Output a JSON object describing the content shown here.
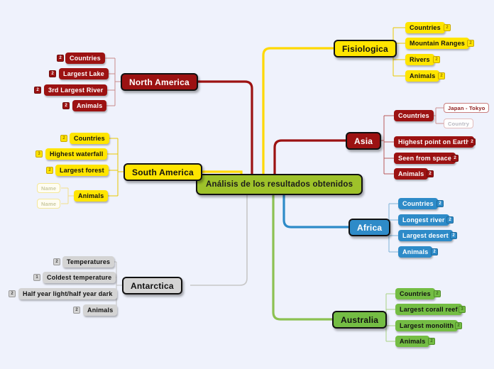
{
  "mindmap": {
    "background_color": "#eff2fc",
    "central": {
      "label": "Análisis de los resultados obtenidos",
      "color": "#9ec22a"
    },
    "branches": [
      {
        "id": "fisiologica",
        "label": "Fisiologica",
        "color": "#ffe500",
        "children": [
          {
            "label": "Countries",
            "badge": "2"
          },
          {
            "label": "Mountain Ranges",
            "badge": "2"
          },
          {
            "label": "Rivers",
            "badge": "2"
          },
          {
            "label": "Animals",
            "badge": "2"
          }
        ]
      },
      {
        "id": "asia",
        "label": "Asia",
        "color": "#9c1212",
        "children": [
          {
            "label": "Countries",
            "badge": "",
            "leaves": [
              {
                "label": "Japan - Tokyo",
                "ghost": false
              },
              {
                "label": "Country",
                "ghost": true
              }
            ]
          },
          {
            "label": "Highest point on Earth",
            "badge": "2"
          },
          {
            "label": "Seen from space",
            "badge": "2"
          },
          {
            "label": "Animals",
            "badge": "2"
          }
        ]
      },
      {
        "id": "africa",
        "label": "Africa",
        "color": "#2e8bc8",
        "children": [
          {
            "label": "Countries",
            "badge": "2"
          },
          {
            "label": "Longest river",
            "badge": "2"
          },
          {
            "label": "Largest desert",
            "badge": "2"
          },
          {
            "label": "Animals",
            "badge": "2"
          }
        ]
      },
      {
        "id": "australia",
        "label": "Australia",
        "color": "#74bd44",
        "children": [
          {
            "label": "Countries",
            "badge": "2"
          },
          {
            "label": "Largest corall reef",
            "badge": "3"
          },
          {
            "label": "Largest monolith",
            "badge": "2"
          },
          {
            "label": "Animals",
            "badge": "2"
          }
        ]
      },
      {
        "id": "north-america",
        "label": "North America",
        "color": "#9c1212",
        "children": [
          {
            "label": "Countries",
            "badge": "2"
          },
          {
            "label": "Largest Lake",
            "badge": "2"
          },
          {
            "label": "3rd Largest River",
            "badge": "2"
          },
          {
            "label": "Animals",
            "badge": "2"
          }
        ]
      },
      {
        "id": "south-america",
        "label": "South America",
        "color": "#ffe500",
        "children": [
          {
            "label": "Countries",
            "badge": "2"
          },
          {
            "label": "Highest waterfall",
            "badge": "3"
          },
          {
            "label": "Largest forest",
            "badge": "2"
          },
          {
            "label": "Animals",
            "badge": "",
            "leaves": [
              {
                "label": "Name",
                "ghost": true
              },
              {
                "label": "Name",
                "ghost": true
              }
            ]
          }
        ]
      },
      {
        "id": "antarctica",
        "label": "Antarctica",
        "color": "#d4d4d4",
        "children": [
          {
            "label": "Temperatures",
            "badge": "2"
          },
          {
            "label": "Coldest temperature",
            "badge": "1"
          },
          {
            "label": "Half year light/half year dark",
            "badge": "2"
          },
          {
            "label": "Animals",
            "badge": "2"
          }
        ]
      }
    ]
  }
}
